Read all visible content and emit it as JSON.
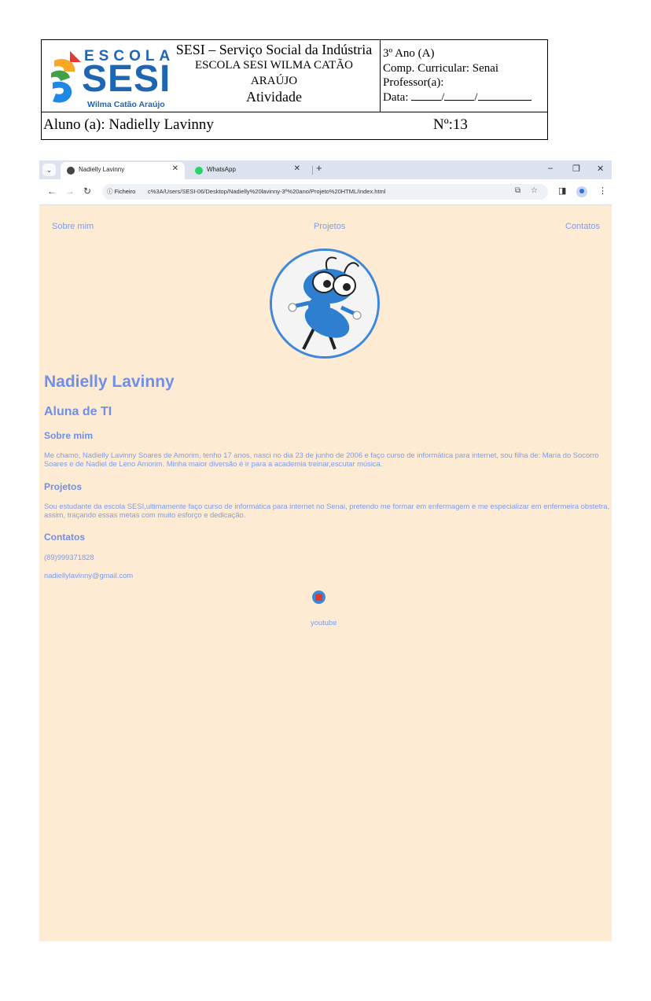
{
  "header": {
    "logo": {
      "top": "ESCOLA",
      "main": "SESI",
      "sub": "Wilma Catão Araújo"
    },
    "institution": "SESI – Serviço Social da Indústria",
    "school_line1": "ESCOLA SESI WILMA CATÃO",
    "school_line2": "ARAÚJO",
    "activity": "Atividade",
    "grade": "3º Ano (A)",
    "component": "Comp. Curricular: Senai",
    "teacher": "Professor(a):",
    "date_label": "Data:",
    "student": "Aluno (a):  Nadielly Lavinny",
    "number": "Nº:13"
  },
  "browser": {
    "tabs": [
      {
        "title": "Nadielly Lavinny",
        "active": true
      },
      {
        "title": "WhatsApp",
        "active": false
      }
    ],
    "info_chip": "Ficheiro",
    "url": "c%3A/Users/SESI-06/Desktop/Nadielly%20lavinny-3º%20ano/Projeto%20HTML/index.html",
    "colors": {
      "page_bg": "#fdebd3",
      "text": "#6f8fe8",
      "tabbar": "#dde3ee"
    }
  },
  "page": {
    "nav": [
      "Sobre mim",
      "Projetos",
      "Contatos"
    ],
    "name": "Nadielly Lavinny",
    "role": "Aluna de TI",
    "about_title": "Sobre mim",
    "about_text": "Me chamo, Nadielly Lavinny Soares de Amorim, tenho 17 anos, nasci no dia 23 de junho de 2006 e faço curso de informática para internet, sou filha de: Maria do Socorro Soares e de Nadiel de Leno Amorim. Minha maior diversão é ir para a academia treinar,escutar música.",
    "projects_title": "Projetos",
    "projects_text": "Sou estudante da escola SESI,ultimamente faço curso de informática para internet no Senai, pretendo me formar em enfermagem e me especializar em enfermeira obstetra, assim, traçando essas metas com muito esforço e dedicação.",
    "contacts_title": "Contatos",
    "phone": "(89)999371828",
    "email": "nadiellylavinny@gmail.com",
    "youtube_label": "youtube",
    "avatar_icon": "cartoon-ant-icon"
  }
}
